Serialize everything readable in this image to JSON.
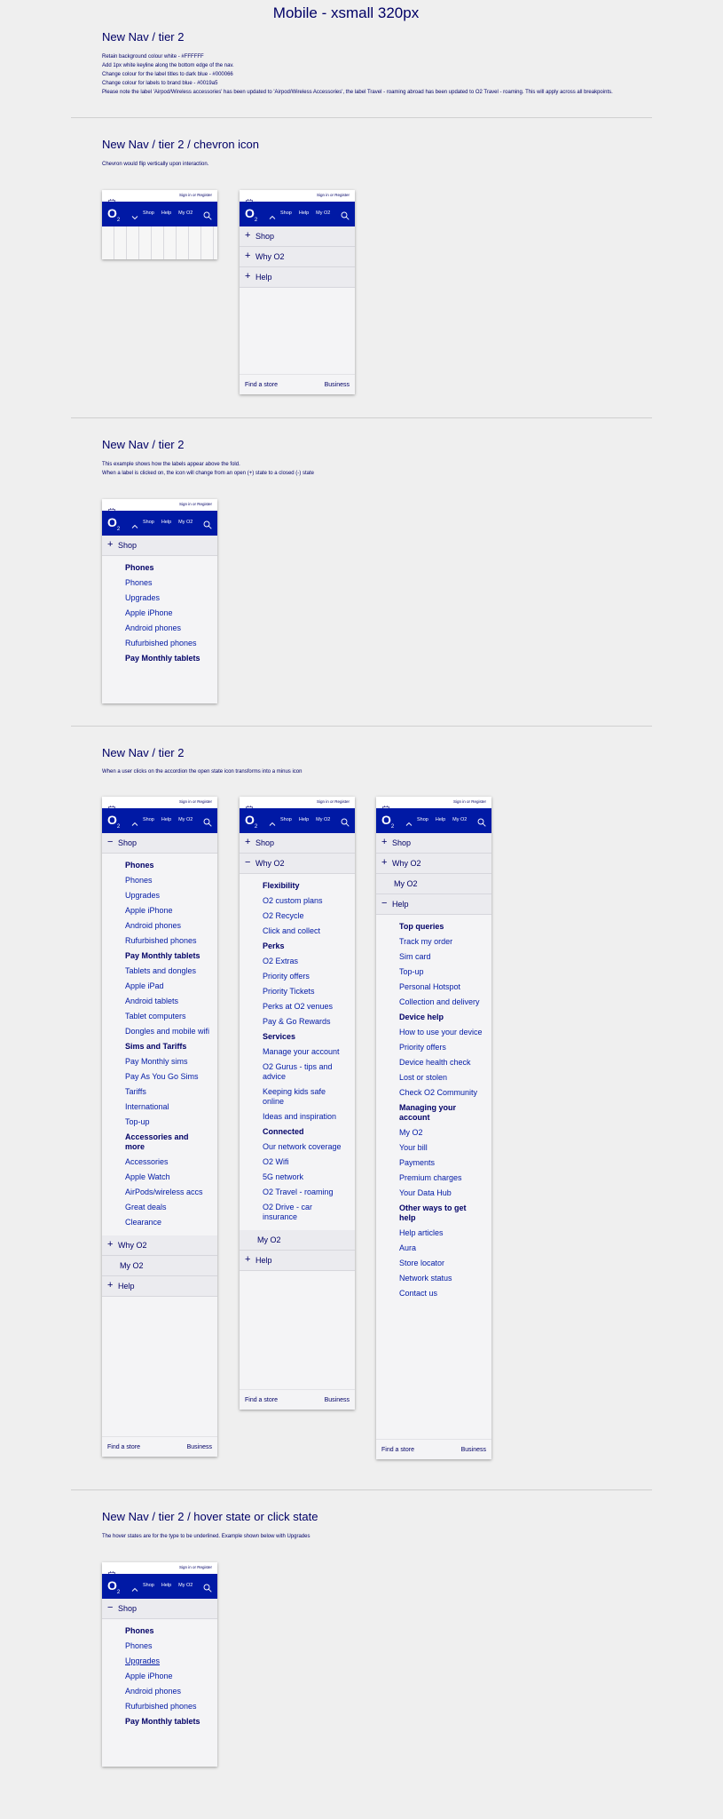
{
  "main_title": "Mobile - xsmall 320px",
  "sections": [
    {
      "title": "New Nav / tier 2",
      "desc": [
        "Retain background colour white - #FFFFFF",
        "Add 1px white keyline along the bottom edge of the nav.",
        "Change colour for the label titles to dark blue - #000066",
        "Change colour for labels to brand blue - #0019a5",
        "Please note the label 'Airpod/Wireless accessories' has been updated to 'Airpod/Wireless Accessories', the label Travel - roaming abroad has been updated to O2 Travel - roaming. This will apply across all breakpoints."
      ]
    },
    {
      "title": "New Nav / tier 2 / chevron icon",
      "desc": [
        "Chevron would flip vertically upon interaction."
      ]
    },
    {
      "title": "New Nav / tier 2",
      "desc": [
        "This example shows how the labels appear above the fold.",
        "When a label is clicked on, the icon will change from an open (+) state to a closed (-) state"
      ]
    },
    {
      "title": "New Nav / tier 2",
      "desc": [
        "When a user clicks on the accordion the open state icon transforms into a minus icon"
      ]
    },
    {
      "title": "New Nav / tier 2 / hover state or click state",
      "desc": [
        "The hover states are for the type to be underlined. Example shown below with Upgrades"
      ]
    }
  ],
  "header": {
    "signin": "Sign in or Register",
    "logo": "O",
    "logo_sub": "2",
    "links": [
      "Shop",
      "Help",
      "My O2"
    ]
  },
  "footer": {
    "left": "Find a store",
    "right": "Business"
  },
  "accordion": {
    "shop": "Shop",
    "why": "Why O2",
    "help": "Help",
    "myo2": "My O2"
  },
  "icons": {
    "plus": "+",
    "minus": "−"
  },
  "shop_short": [
    {
      "t": "Phones",
      "h": true
    },
    {
      "t": "Phones"
    },
    {
      "t": "Upgrades"
    },
    {
      "t": "Apple iPhone"
    },
    {
      "t": "Android phones"
    },
    {
      "t": "Rufurbished phones"
    },
    {
      "t": "Pay Monthly tablets",
      "h": true
    }
  ],
  "shop_hover": [
    {
      "t": "Phones",
      "h": true
    },
    {
      "t": "Phones"
    },
    {
      "t": "Upgrades",
      "u": true
    },
    {
      "t": "Apple iPhone"
    },
    {
      "t": "Android phones"
    },
    {
      "t": "Rufurbished phones"
    },
    {
      "t": "Pay Monthly tablets",
      "h": true
    }
  ],
  "shop_full": [
    {
      "t": "Phones",
      "h": true
    },
    {
      "t": "Phones"
    },
    {
      "t": "Upgrades"
    },
    {
      "t": "Apple iPhone"
    },
    {
      "t": "Android phones"
    },
    {
      "t": "Rufurbished phones"
    },
    {
      "t": "Pay Monthly tablets",
      "h": true
    },
    {
      "t": "Tablets and dongles"
    },
    {
      "t": "Apple iPad"
    },
    {
      "t": "Android tablets"
    },
    {
      "t": "Tablet computers"
    },
    {
      "t": "Dongles and mobile wifi"
    },
    {
      "t": "Sims and Tariffs",
      "h": true
    },
    {
      "t": "Pay Monthly sims"
    },
    {
      "t": "Pay As You Go Sims"
    },
    {
      "t": "Tariffs"
    },
    {
      "t": "International"
    },
    {
      "t": "Top-up"
    },
    {
      "t": "Accessories and more",
      "h": true
    },
    {
      "t": "Accessories"
    },
    {
      "t": "Apple Watch"
    },
    {
      "t": "AirPods/wireless accs"
    },
    {
      "t": "Great deals"
    },
    {
      "t": "Clearance"
    }
  ],
  "why_full": [
    {
      "t": "Flexibility",
      "h": true
    },
    {
      "t": "O2 custom plans"
    },
    {
      "t": "O2 Recycle"
    },
    {
      "t": "Click and collect"
    },
    {
      "t": "Perks",
      "h": true
    },
    {
      "t": "O2 Extras"
    },
    {
      "t": "Priority offers"
    },
    {
      "t": "Priority Tickets"
    },
    {
      "t": "Perks at O2 venues"
    },
    {
      "t": "Pay & Go Rewards"
    },
    {
      "t": "Services",
      "h": true
    },
    {
      "t": "Manage your account"
    },
    {
      "t": "O2 Gurus - tips and advice"
    },
    {
      "t": "Keeping kids safe online"
    },
    {
      "t": "Ideas and inspiration"
    },
    {
      "t": "Connected",
      "h": true
    },
    {
      "t": "Our network coverage"
    },
    {
      "t": "O2 Wifi"
    },
    {
      "t": "5G network"
    },
    {
      "t": "O2 Travel - roaming"
    },
    {
      "t": "O2 Drive - car insurance"
    }
  ],
  "help_full": [
    {
      "t": "Top queries",
      "h": true
    },
    {
      "t": "Track my order"
    },
    {
      "t": "Sim card"
    },
    {
      "t": "Top-up"
    },
    {
      "t": "Personal Hotspot"
    },
    {
      "t": "Collection and delivery"
    },
    {
      "t": "Device help",
      "h": true
    },
    {
      "t": "How to use your device"
    },
    {
      "t": "Priority offers"
    },
    {
      "t": "Device health check"
    },
    {
      "t": "Lost or stolen"
    },
    {
      "t": "Check O2 Community"
    },
    {
      "t": "Managing your account",
      "h": true
    },
    {
      "t": "My O2"
    },
    {
      "t": "Your bill"
    },
    {
      "t": "Payments"
    },
    {
      "t": "Premium charges"
    },
    {
      "t": "Your Data Hub"
    },
    {
      "t": "Other ways to get help",
      "h": true
    },
    {
      "t": "Help articles"
    },
    {
      "t": "Aura"
    },
    {
      "t": "Store locator"
    },
    {
      "t": "Network status"
    },
    {
      "t": "Contact us"
    }
  ]
}
